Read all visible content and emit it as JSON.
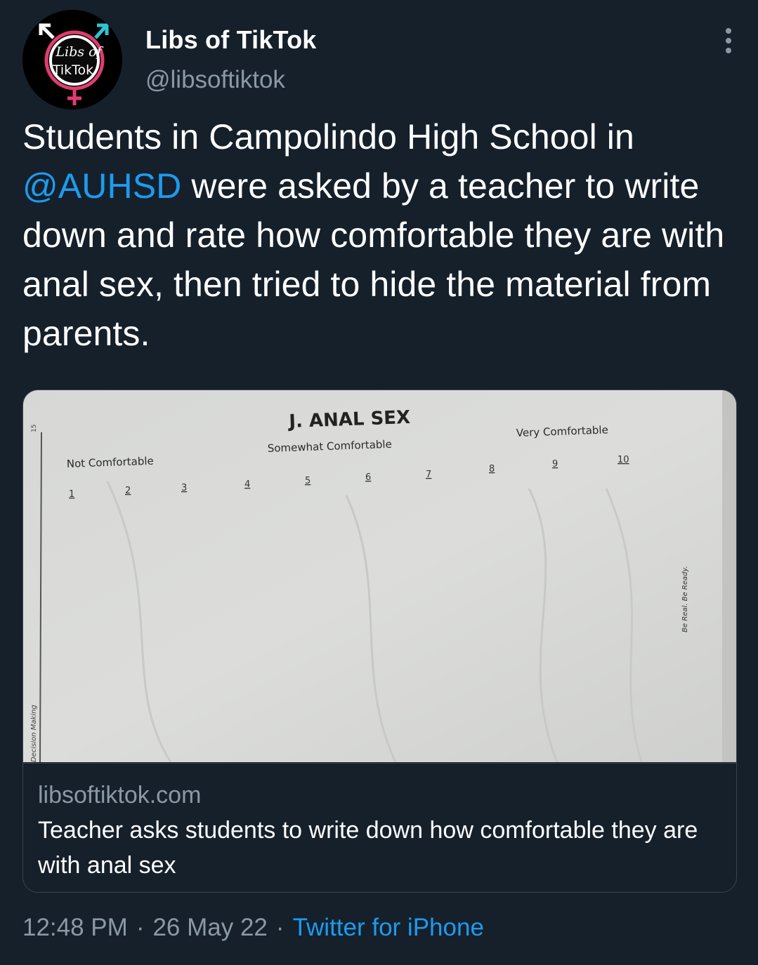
{
  "tweet": {
    "author": {
      "display_name": "Libs of TikTok",
      "handle": "@libsoftiktok",
      "avatar_text_line1": "Libs of",
      "avatar_text_line2": "TikTok"
    },
    "more_icon": "more-horizontal-icon",
    "text_before_mention": "Students in Campolindo High School in ",
    "mention": "@AUHSD",
    "text_after_mention": " were asked by a teacher to write down and rate how comfortable they are with anal sex, then tried to hide the material from parents.",
    "time": "12:48 PM",
    "date": "26 May 22",
    "source": "Twitter for iPhone",
    "separator": "·"
  },
  "link_card": {
    "domain": "libsoftiktok.com",
    "title": "Teacher asks students to write down how comfortable they are with anal sex",
    "photo": {
      "heading": "J. ANAL SEX",
      "label_low": "Not Comfortable",
      "label_mid": "Somewhat  Comfortable",
      "label_high": "Very Comfortable",
      "scale": [
        "1",
        "2",
        "3",
        "4",
        "5",
        "6",
        "7",
        "8",
        "9",
        "10"
      ],
      "side_text_right": "Be Real. Be Ready.",
      "side_text_left": "Decision Making",
      "page_number": "15"
    }
  },
  "colors": {
    "background": "#15202b",
    "text_primary": "#ffffff",
    "text_secondary": "#8b98a5",
    "link": "#1d9bf0",
    "border": "#38444d"
  }
}
